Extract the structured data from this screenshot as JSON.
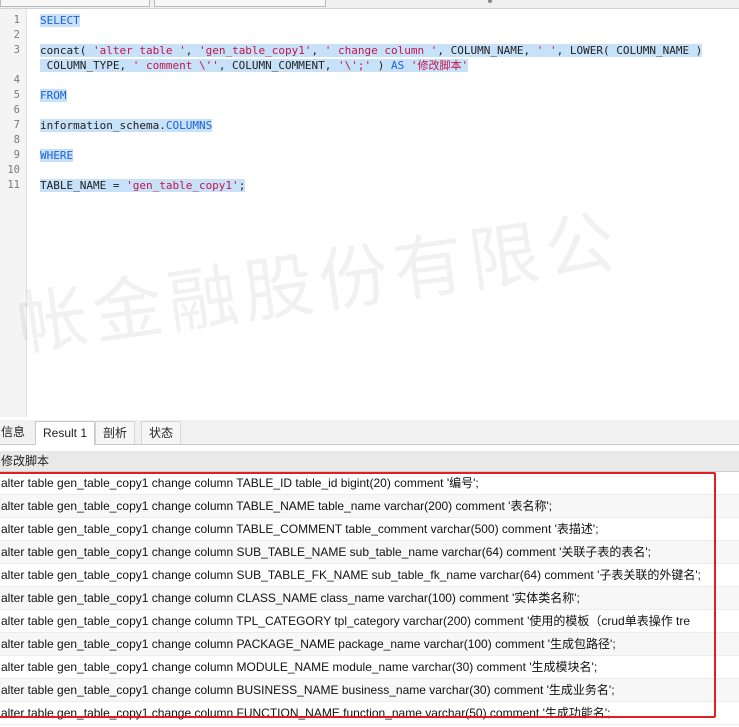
{
  "editor": {
    "lines": [
      {
        "num": "1",
        "segments": [
          {
            "t": "SELECT",
            "c": "kw"
          }
        ]
      },
      {
        "num": "2",
        "segments": []
      },
      {
        "num": "3",
        "segments": [
          {
            "t": "concat( ",
            "c": ""
          },
          {
            "t": "'alter table '",
            "c": "str"
          },
          {
            "t": ", ",
            "c": ""
          },
          {
            "t": "'gen_table_copy1'",
            "c": "str"
          },
          {
            "t": ", ",
            "c": ""
          },
          {
            "t": "' change column '",
            "c": "str"
          },
          {
            "t": ", COLUMN_NAME, ",
            "c": ""
          },
          {
            "t": "' '",
            "c": "str"
          },
          {
            "t": ", LOWER( COLUMN_NAME )",
            "c": ""
          }
        ]
      },
      {
        "num": "",
        "segments": [
          {
            "t": " COLUMN_TYPE, ",
            "c": ""
          },
          {
            "t": "' comment \\''",
            "c": "str"
          },
          {
            "t": ", COLUMN_COMMENT, ",
            "c": ""
          },
          {
            "t": "'\\';'",
            "c": "str"
          },
          {
            "t": " ) ",
            "c": ""
          },
          {
            "t": "AS",
            "c": "kw"
          },
          {
            "t": " ",
            "c": ""
          },
          {
            "t": "'修改脚本'",
            "c": "str"
          }
        ]
      },
      {
        "num": "4",
        "segments": []
      },
      {
        "num": "5",
        "segments": [
          {
            "t": "FROM",
            "c": "kw"
          }
        ]
      },
      {
        "num": "6",
        "segments": []
      },
      {
        "num": "7",
        "segments": [
          {
            "t": "information_schema.",
            "c": ""
          },
          {
            "t": "COLUMNS",
            "c": "kw"
          }
        ]
      },
      {
        "num": "8",
        "segments": []
      },
      {
        "num": "9",
        "segments": [
          {
            "t": "WHERE",
            "c": "kw"
          }
        ]
      },
      {
        "num": "10",
        "segments": []
      },
      {
        "num": "11",
        "segments": [
          {
            "t": "TABLE_NAME = ",
            "c": ""
          },
          {
            "t": "'gen_table_copy1'",
            "c": "str"
          },
          {
            "t": ";",
            "c": ""
          }
        ]
      }
    ]
  },
  "watermark": "帐金融股份有限公",
  "tabs": {
    "info": "信息",
    "result": "Result 1",
    "profile": "剖析",
    "status": "状态"
  },
  "grid": {
    "column_header": "修改脚本",
    "rows": [
      "alter table gen_table_copy1 change column TABLE_ID table_id bigint(20) comment '编号';",
      "alter table gen_table_copy1 change column TABLE_NAME table_name varchar(200) comment '表名称';",
      "alter table gen_table_copy1 change column TABLE_COMMENT table_comment varchar(500) comment '表描述';",
      "alter table gen_table_copy1 change column SUB_TABLE_NAME sub_table_name varchar(64) comment '关联子表的表名';",
      "alter table gen_table_copy1 change column SUB_TABLE_FK_NAME sub_table_fk_name varchar(64) comment '子表关联的外键名';",
      "alter table gen_table_copy1 change column CLASS_NAME class_name varchar(100) comment '实体类名称';",
      "alter table gen_table_copy1 change column TPL_CATEGORY tpl_category varchar(200) comment '使用的模板（crud单表操作 tre",
      "alter table gen_table_copy1 change column PACKAGE_NAME package_name varchar(100) comment '生成包路径';",
      "alter table gen_table_copy1 change column MODULE_NAME module_name varchar(30) comment '生成模块名';",
      "alter table gen_table_copy1 change column BUSINESS_NAME business_name varchar(30) comment '生成业务名';",
      "alter table gen_table_copy1 change column FUNCTION_NAME function_name varchar(50) comment '生成功能名';"
    ]
  }
}
